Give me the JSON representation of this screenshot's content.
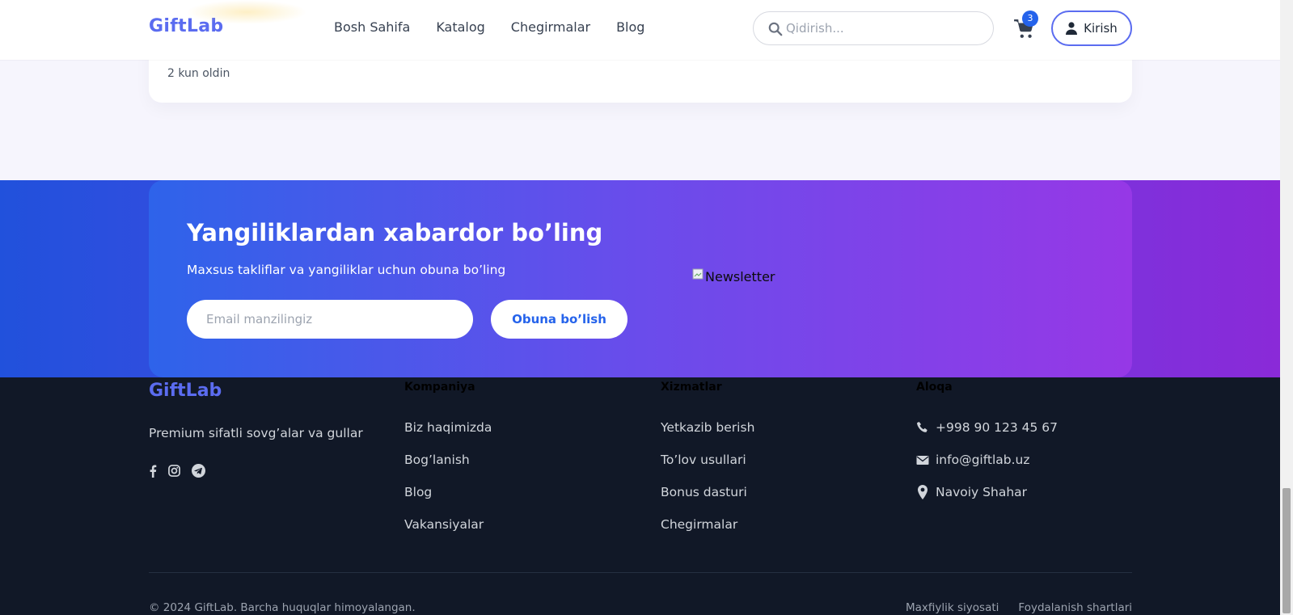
{
  "header": {
    "logo": "GiftLab",
    "nav": [
      "Bosh Sahifa",
      "Katalog",
      "Chegirmalar",
      "Blog"
    ],
    "search_placeholder": "Qidirish...",
    "cart_count": "3",
    "login_label": "Kirish"
  },
  "card": {
    "time": "2 kun oldin"
  },
  "newsletter": {
    "title": "Yangiliklardan xabardor bo’ling",
    "subtitle": "Maxsus takliflar va yangiliklar uchun obuna bo’ling",
    "email_placeholder": "Email manzilingiz",
    "button": "Obuna bo’lish",
    "image_alt": "Newsletter"
  },
  "footer": {
    "logo": "GiftLab",
    "tagline": "Premium sifatli sovg’alar va gullar",
    "social": [
      "facebook-icon",
      "instagram-icon",
      "telegram-icon"
    ],
    "columns": [
      {
        "title": "Kompaniya",
        "items": [
          "Biz haqimizda",
          "Bog’lanish",
          "Blog",
          "Vakansiyalar"
        ]
      },
      {
        "title": "Xizmatlar",
        "items": [
          "Yetkazib berish",
          "To’lov usullari",
          "Bonus dasturi",
          "Chegirmalar"
        ]
      },
      {
        "title": "Aloqa",
        "items": [
          "+998 90 123 45 67",
          "info@giftlab.uz",
          "Navoiy Shahar"
        ]
      }
    ],
    "copyright": "© 2024 GiftLab. Barcha huquqlar himoyalangan.",
    "legal": [
      "Maxfiylik siyosati",
      "Foydalanish shartlari"
    ]
  },
  "colors": {
    "brand": "#5b6cf0",
    "accent": "#2563eb",
    "footer_bg": "#111827",
    "gradient_start": "#2e63ea",
    "gradient_end": "#9638e6"
  }
}
